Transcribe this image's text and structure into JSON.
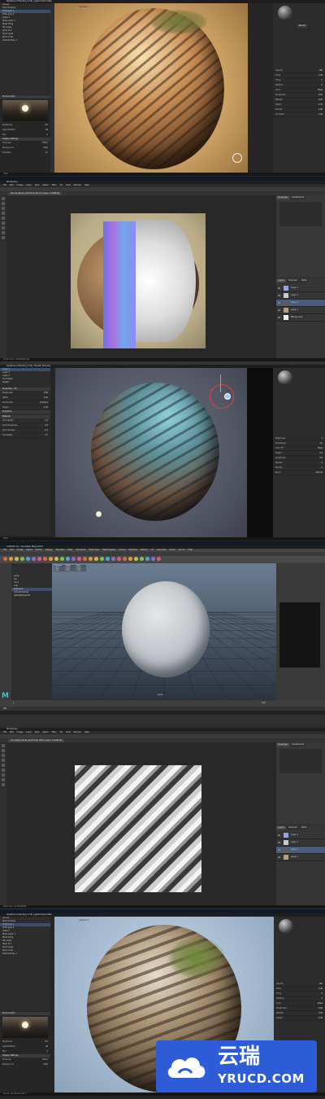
{
  "panels": {
    "p1": {
      "title": "Substance Painting 2.56 | galleria Rocolate",
      "viewport_label": "Camera 1",
      "outliner": [
        "Groups",
        "Rock Scheme",
        "Cliff Layer 1",
        "Cliff Layer 2",
        "Grass 1",
        "Moss Layer 1",
        "Mask Tiling",
        "Top Layer",
        "Sand Lt 1",
        "Sand Layer",
        "Rock Cover",
        "Dust Overlay 1"
      ],
      "env_header": "Environment",
      "env_props": [
        [
          "Brightness",
          "0.5"
        ],
        [
          "Light Rotation",
          "45"
        ],
        [
          "Blur",
          "2"
        ]
      ],
      "display_header": "Display Settings",
      "display_props": [
        [
          "Tonemap",
          "Filmic"
        ],
        [
          "Background",
          "Solid"
        ],
        [
          "Shadows",
          "On"
        ]
      ],
      "render_tab": "Render",
      "layer_props": [
        [
          "Opacity",
          "100"
        ],
        [
          "Scale",
          "1.00"
        ],
        [
          "Tiling",
          "2"
        ],
        [
          "Rotation",
          "0"
        ],
        [
          "Color",
          "Base"
        ],
        [
          "Roughness",
          "0.62"
        ],
        [
          "Metallic",
          "0.00"
        ],
        [
          "Height",
          "0.35"
        ],
        [
          "Normal",
          "1.00"
        ],
        [
          "Occlusion",
          "1.00"
        ]
      ],
      "shelf_label": "Shelf",
      "status": "Scene: 2/2  Texture Set: 1"
    },
    "p2": {
      "title": "Photoshop",
      "doc_tab": "Normal_Rocks_pt32.tif @ 16.7% (Layer 1, RGB/16)",
      "menus": [
        "File",
        "Edit",
        "Image",
        "Layer",
        "Type",
        "Select",
        "Filter",
        "3D",
        "View",
        "Window",
        "Help"
      ],
      "panel_tabs": [
        "Properties",
        "Adjustments"
      ],
      "layers_tabs": [
        "Layers",
        "Channels",
        "Paths"
      ],
      "layers": [
        "Layer 4",
        "Layer 3",
        "Layer 2",
        "Layer 1",
        "Background"
      ],
      "status": "16.67%  Doc: 48.0M/192.0M"
    },
    "p3": {
      "title": "Substance Painting 2.56 | Shader Preview",
      "tree": [
        "Layer 1",
        "Layer 2",
        "Layer 3",
        "Rock Mask",
        "Height"
      ],
      "props_header": "Properties - Fill",
      "props": [
        [
          "Roughness",
          "0.60"
        ],
        [
          "Offset",
          "0.00"
        ],
        [
          "Normal Mix",
          "Combine"
        ],
        [
          "Height",
          "0.35"
        ]
      ],
      "sections": [
        "Projection",
        "Material"
      ],
      "mat_props": [
        [
          "Spot Height",
          "1.0"
        ],
        [
          "Spot Roughness",
          "0.5"
        ],
        [
          "Spot Variation",
          "0.2"
        ],
        [
          "Sand Ratio",
          "0.7"
        ]
      ],
      "right_props": [
        [
          "Brightness",
          "1"
        ],
        [
          "Shadowing",
          "On"
        ],
        [
          "Color Fill",
          "Base"
        ],
        [
          "Height",
          "0.4"
        ],
        [
          "Roughness",
          "0.6"
        ],
        [
          "Metallic",
          "0"
        ],
        [
          "Normal",
          "1"
        ],
        [
          "Blend",
          "Normal"
        ]
      ],
      "status": "Shelf"
    },
    "p4": {
      "title": "Untitled.ma - Autodesk Maya 2017",
      "menus": [
        "File",
        "Edit",
        "Create",
        "Select",
        "Modify",
        "Display",
        "Windows",
        "Mesh",
        "Edit Mesh",
        "Mesh Tools",
        "Mesh Display",
        "Curves",
        "Surfaces",
        "Deform",
        "UV",
        "Generate",
        "Cache",
        "Arnold",
        "Help"
      ],
      "outliner": [
        "persp",
        "top",
        "front",
        "side",
        "pSphere1",
        "defaultLightSet",
        "defaultObjectSet"
      ],
      "attr_cols": [
        "Translate",
        "Rotate",
        "Scale"
      ],
      "attr_rows": [
        [
          "0.000",
          "0.000",
          "1.000"
        ],
        [
          "0.000",
          "0.000",
          "1.000"
        ],
        [
          "0.000",
          "0.000",
          "1.000"
        ]
      ],
      "viewport_label": "persp",
      "timeline_start": "1",
      "timeline_end": "120",
      "command_label": "MEL",
      "logo": "M"
    },
    "p5": {
      "title": "Photoshop",
      "doc_tab": "AO_Height_Rocks_pt12.tif @ 100% (Layer 1, RGB/16)",
      "menus": [
        "File",
        "Edit",
        "Image",
        "Layer",
        "Type",
        "Select",
        "Filter",
        "3D",
        "View",
        "Window",
        "Help"
      ],
      "panel_tabs": [
        "Properties",
        "Adjustments"
      ],
      "layers_tabs": [
        "Layers",
        "Channels",
        "Paths"
      ],
      "layers": [
        "Layer 4",
        "Layer 3",
        "Layer 2",
        "Layer 1"
      ],
      "status": "100%  Doc: 12.0M/48.0M"
    },
    "p6": {
      "title": "Substance Painting 2.56 | galleria Rocolate",
      "viewport_label": "Camera 1",
      "outliner": [
        "Groups",
        "Rock Scheme",
        "Cliff Layer 1",
        "Cliff Layer 2",
        "Grass 1",
        "Moss Layer 1",
        "Mask Tiling",
        "Top Layer",
        "Sand Lt 1",
        "Sand Layer",
        "Rock Cover",
        "Dust Overlay 1"
      ],
      "env_header": "Environment",
      "env_props": [
        [
          "Brightness",
          "0.5"
        ],
        [
          "Light Rotation",
          "45"
        ],
        [
          "Blur",
          "2"
        ]
      ],
      "display_header": "Display Settings",
      "display_props": [
        [
          "Tonemap",
          "Filmic"
        ],
        [
          "Background",
          "Solid"
        ]
      ],
      "layer_props": [
        [
          "Opacity",
          "100"
        ],
        [
          "Scale",
          "1.00"
        ],
        [
          "Tiling",
          "2"
        ],
        [
          "Rotation",
          "0"
        ],
        [
          "Color",
          "Base"
        ],
        [
          "Roughness",
          "0.62"
        ],
        [
          "Metallic",
          "0.00"
        ],
        [
          "Height",
          "0.35"
        ]
      ],
      "status": "Scene: 2/2  Texture Set: 1"
    }
  },
  "watermark": {
    "cn_text": "云瑞",
    "url_text": "YRUCD.COM"
  },
  "colors": {
    "app_dark": "#2c2c2c",
    "ps_dark": "#323232",
    "maya_bg": "#444444",
    "accent_blue": "#3b4e6e",
    "watermark_blue": "#2e5bd8"
  }
}
